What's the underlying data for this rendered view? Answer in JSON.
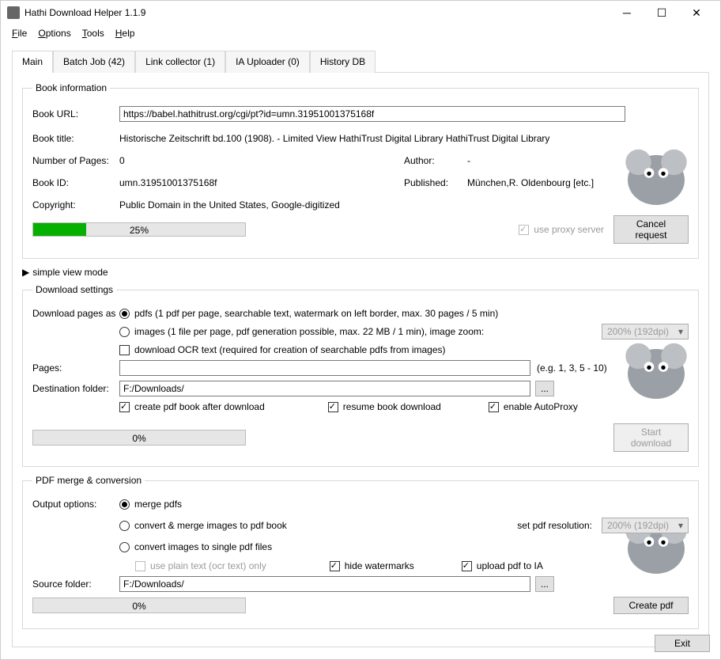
{
  "window": {
    "title": "Hathi Download Helper 1.1.9"
  },
  "menu": {
    "file": "File",
    "options": "Options",
    "tools": "Tools",
    "help": "Help"
  },
  "tabs": {
    "main": "Main",
    "batch": "Batch Job (42)",
    "link": "Link collector (1)",
    "ia": "IA Uploader (0)",
    "hist": "History DB"
  },
  "book_info": {
    "legend": "Book information",
    "url_label": "Book URL:",
    "url": "https://babel.hathitrust.org/cgi/pt?id=umn.31951001375168f",
    "title_label": "Book title:",
    "title": "Historische Zeitschrift bd.100 (1908). - Limited View  HathiTrust Digital Library  HathiTrust Digital Library",
    "pages_label": "Number of Pages:",
    "pages": "0",
    "author_label": "Author:",
    "author": "-",
    "id_label": "Book ID:",
    "id": "umn.31951001375168f",
    "published_label": "Published:",
    "published": "München,R. Oldenbourg [etc.]",
    "copyright_label": "Copyright:",
    "copyright": "Public Domain in the United States, Google-digitized",
    "progress_pct": "25%",
    "proxy_label": "use proxy server",
    "cancel": "Cancel request"
  },
  "simple_view": "simple view mode",
  "download": {
    "legend": "Download settings",
    "pages_as_label": "Download pages as",
    "pdfs": "pdfs (1 pdf per page, searchable text,  watermark on left border,  max. 30 pages / 5 min)",
    "images": "images (1 file per page, pdf generation possible, max. 22 MB / 1 min), image zoom:",
    "zoom": "200% (192dpi)",
    "ocr": "download OCR text (required for creation of searchable pdfs from images)",
    "pages_label": "Pages:",
    "pages_hint": "(e.g. 1, 3, 5 - 10)",
    "dest_label": "Destination folder:",
    "dest": "F:/Downloads/",
    "create_pdf": "create pdf book after download",
    "resume": "resume book download",
    "autoproxy": "enable AutoProxy",
    "progress": "0%",
    "start": "Start download"
  },
  "merge": {
    "legend": "PDF merge & conversion",
    "output_label": "Output options:",
    "merge_pdfs": "merge pdfs",
    "convert_merge": "convert & merge images to pdf book",
    "resolution_label": "set pdf resolution:",
    "resolution": "200% (192dpi)",
    "convert_single": "convert images to single pdf files",
    "plain_text": "use plain text (ocr text) only",
    "hide_wm": "hide watermarks",
    "upload_ia": "upload pdf to IA",
    "source_label": "Source folder:",
    "source": "F:/Downloads/",
    "progress": "0%",
    "create": "Create pdf"
  },
  "footer": {
    "exit": "Exit"
  }
}
